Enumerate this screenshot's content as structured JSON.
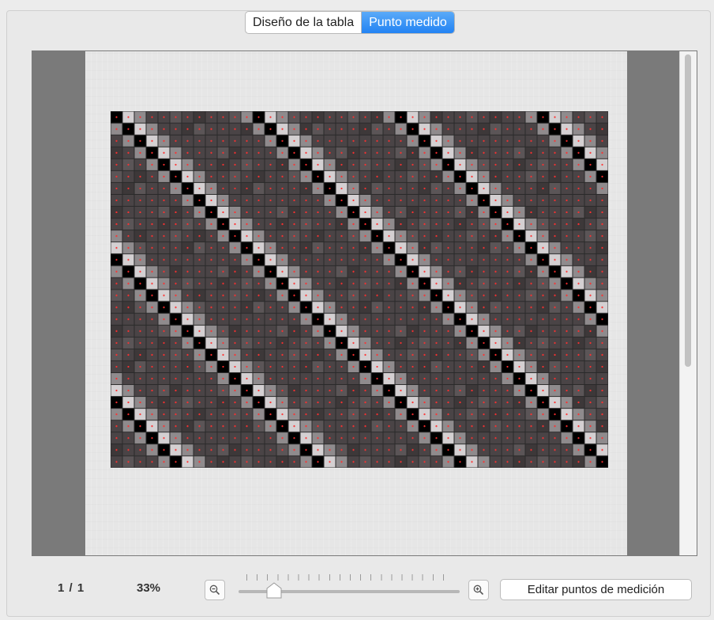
{
  "tabs": [
    {
      "label": "Diseño de la tabla",
      "active": false
    },
    {
      "label": "Punto medido",
      "active": true
    }
  ],
  "preview": {
    "chart_type": "color patch test chart",
    "grid_columns": 42,
    "grid_rows": 30,
    "patch_colors": [
      "#4a4446",
      "#5b5557",
      "#3d3839",
      "#8f8b8d",
      "#000000",
      "#d4d0d2"
    ],
    "marker_color": "#ff3030"
  },
  "footer": {
    "page_counter": "1 / 1",
    "zoom_percent": "33%",
    "zoom_level": 0.13,
    "edit_button_label": "Editar puntos de medición"
  },
  "icons": {
    "zoom_out": "zoom-out-icon",
    "zoom_in": "zoom-in-icon"
  }
}
